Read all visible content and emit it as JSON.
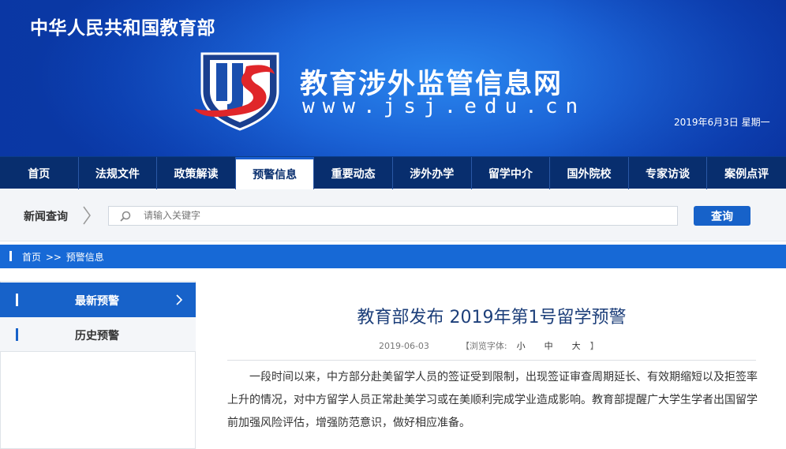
{
  "header": {
    "ministry": "中华人民共和国教育部",
    "site_title": "教育涉外监管信息网",
    "site_url": "www.jsj.edu.cn",
    "date": "2019年6月3日  星期一"
  },
  "nav": {
    "items": [
      {
        "label": "首页"
      },
      {
        "label": "法规文件"
      },
      {
        "label": "政策解读"
      },
      {
        "label": "预警信息"
      },
      {
        "label": "重要动态"
      },
      {
        "label": "涉外办学"
      },
      {
        "label": "留学中介"
      },
      {
        "label": "国外院校"
      },
      {
        "label": "专家访谈"
      },
      {
        "label": "案例点评"
      }
    ],
    "active_index": 3
  },
  "search": {
    "label": "新闻查询",
    "placeholder": "请输入关键字",
    "button": "查询"
  },
  "breadcrumb": {
    "home": "首页",
    "separator": ">>",
    "current": "预警信息"
  },
  "sidebar": {
    "items": [
      {
        "label": "最新预警"
      },
      {
        "label": "历史预警"
      }
    ]
  },
  "article": {
    "title": "教育部发布 2019年第1号留学预警",
    "date": "2019-06-03",
    "font_prefix": "【浏览字体:",
    "font_small": "小",
    "font_medium": "中",
    "font_large": "大",
    "font_suffix": "】",
    "body": "一段时间以来，中方部分赴美留学人员的签证受到限制，出现签证审查周期延长、有效期缩短以及拒签率上升的情况，对中方留学人员正常赴美学习或在美顺利完成学业造成影响。教育部提醒广大学生学者出国留学前加强风险评估，增强防范意识，做好相应准备。"
  },
  "colors": {
    "nav_bg": "#082e6e",
    "accent": "#1762c9",
    "breadcrumb_bg": "#1769d6",
    "title_color": "#1d3f7a"
  }
}
